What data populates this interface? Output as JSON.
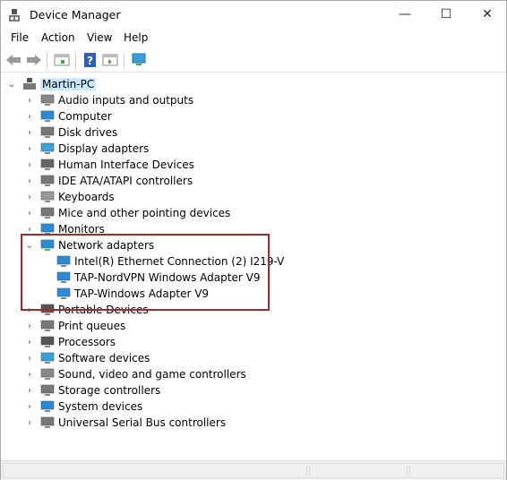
{
  "window": {
    "title": "Device Manager",
    "minimize": "—",
    "maximize": "☐",
    "close": "✕"
  },
  "menu": [
    "File",
    "Action",
    "View",
    "Help"
  ],
  "toolbar": [
    "back-icon",
    "forward-icon",
    "properties-icon",
    "help-icon",
    "driver-icon",
    "monitor-icon"
  ],
  "tree": {
    "root": "Martin-PC",
    "items": [
      {
        "label": "Audio inputs and outputs",
        "icon": "speaker-icon",
        "color": "#888"
      },
      {
        "label": "Computer",
        "icon": "computer-icon",
        "color": "#2a8ad8"
      },
      {
        "label": "Disk drives",
        "icon": "disk-icon",
        "color": "#777"
      },
      {
        "label": "Display adapters",
        "icon": "display-icon",
        "color": "#3aa0d8"
      },
      {
        "label": "Human Interface Devices",
        "icon": "hid-icon",
        "color": "#666"
      },
      {
        "label": "IDE ATA/ATAPI controllers",
        "icon": "ide-icon",
        "color": "#777"
      },
      {
        "label": "Keyboards",
        "icon": "keyboard-icon",
        "color": "#999"
      },
      {
        "label": "Mice and other pointing devices",
        "icon": "mouse-icon",
        "color": "#777"
      },
      {
        "label": "Monitors",
        "icon": "monitor-icon",
        "color": "#2a8ad8"
      },
      {
        "label": "Network adapters",
        "icon": "network-icon",
        "color": "#2a8ad8",
        "expanded": true,
        "children": [
          "Intel(R) Ethernet Connection (2) I219-V",
          "TAP-NordVPN Windows Adapter V9",
          "TAP-Windows Adapter V9"
        ]
      },
      {
        "label": "Portable Devices",
        "icon": "portable-icon",
        "color": "#555"
      },
      {
        "label": "Print queues",
        "icon": "printer-icon",
        "color": "#777"
      },
      {
        "label": "Processors",
        "icon": "processor-icon",
        "color": "#555"
      },
      {
        "label": "Software devices",
        "icon": "software-icon",
        "color": "#3aa0d8"
      },
      {
        "label": "Sound, video and game controllers",
        "icon": "sound-icon",
        "color": "#888"
      },
      {
        "label": "Storage controllers",
        "icon": "storage-icon",
        "color": "#777"
      },
      {
        "label": "System devices",
        "icon": "system-icon",
        "color": "#2a8ad8"
      },
      {
        "label": "Universal Serial Bus controllers",
        "icon": "usb-icon",
        "color": "#777"
      }
    ]
  },
  "highlight_color": "#a32a2f"
}
